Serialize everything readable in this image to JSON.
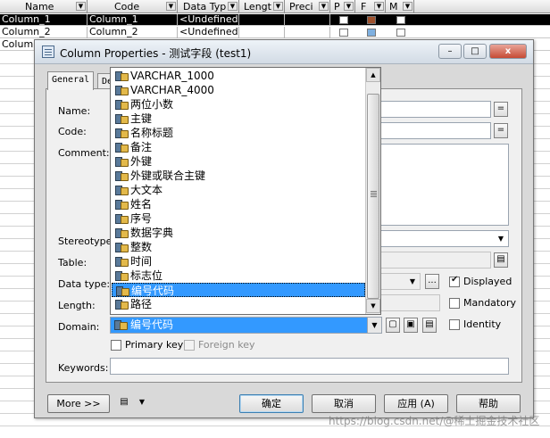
{
  "grid": {
    "headers": [
      "Name",
      "Code",
      "Data Typ",
      "Lengt",
      "Preci",
      "P",
      "F",
      "M"
    ],
    "rows": [
      {
        "name": "Column_1",
        "code": "Column_1",
        "type": "<Undefined>"
      },
      {
        "name": "Column_2",
        "code": "Column_2",
        "type": "<Undefined>"
      },
      {
        "name": "Colum",
        "code": "",
        "type": ""
      }
    ]
  },
  "dialog": {
    "title": "Column Properties - 测试字段 (test1)",
    "window_buttons": {
      "minimize": "–",
      "maximize": "□",
      "close": "x"
    },
    "tabs": [
      "General",
      "De"
    ],
    "labels": {
      "name": "Name:",
      "code": "Code:",
      "comment": "Comment:",
      "stereotype": "Stereotype:",
      "table": "Table:",
      "data_type": "Data type:",
      "length": "Length:",
      "domain": "Domain:",
      "keywords": "Keywords:"
    },
    "domain_value": "编号代码",
    "equals": "=",
    "ellipsis": "...",
    "checkboxes": {
      "displayed": "Displayed",
      "mandatory": "Mandatory",
      "identity": "Identity",
      "primary_key": "Primary key",
      "foreign_key": "Foreign key"
    },
    "buttons": {
      "more": "More >>",
      "ok": "确定",
      "cancel": "取消",
      "apply": "应用 (A)",
      "help": "帮助"
    }
  },
  "domain_list": {
    "items": [
      "VARCHAR_1000",
      "VARCHAR_4000",
      "两位小数",
      "主键",
      "名称标题",
      "备注",
      "外键",
      "外键或联合主键",
      "大文本",
      "姓名",
      "序号",
      "数据字典",
      "整数",
      "时间",
      "标志位",
      "编号代码",
      "路径"
    ],
    "selected_index": 15
  },
  "watermark": "https://blog.csdn.net/@稀土掘金技术社区"
}
